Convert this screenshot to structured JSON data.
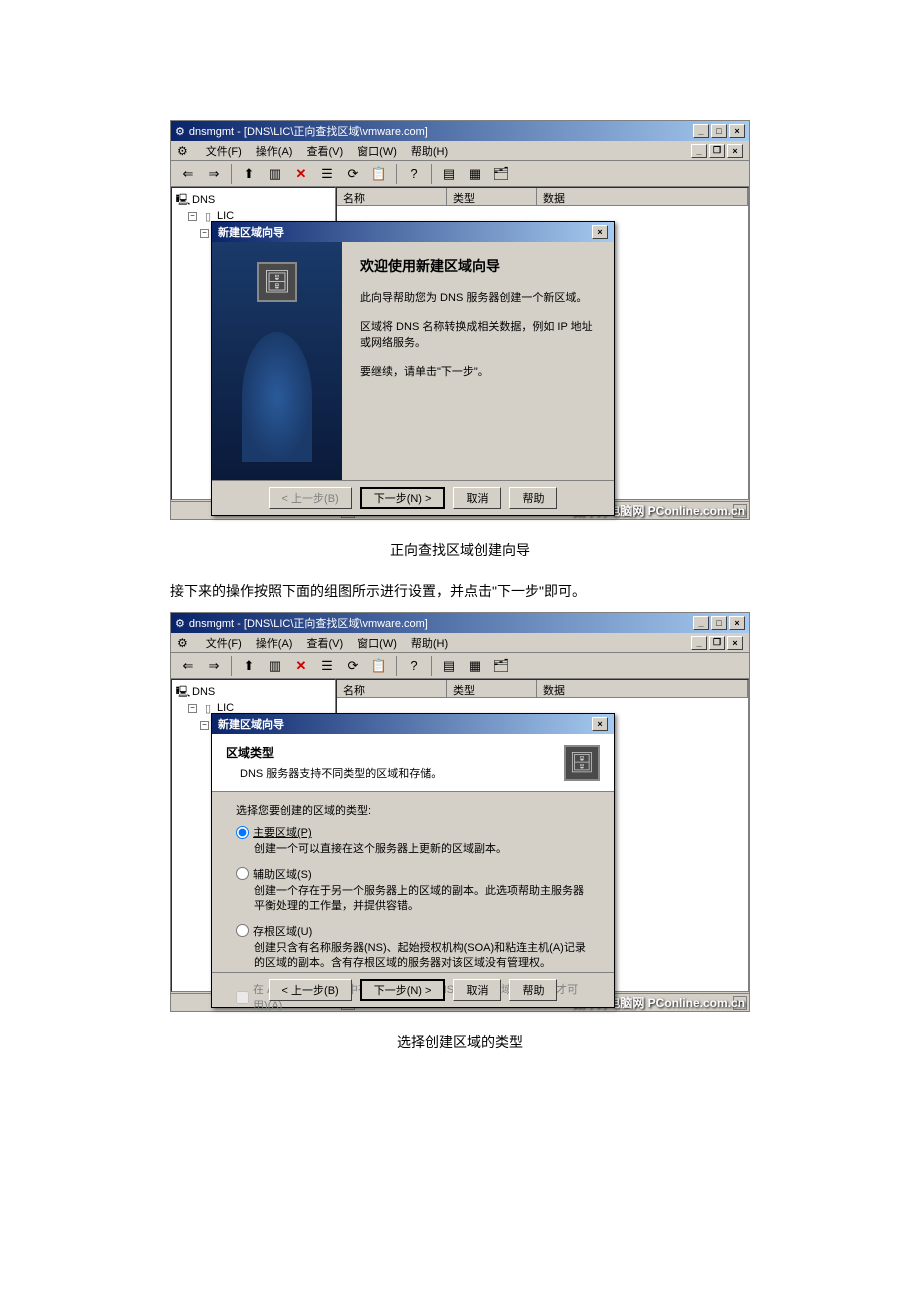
{
  "caption1": "正向查找区域创建向导",
  "desc_text": "接下来的操作按照下面的组图所示进行设置，并点击\"下一步\"即可。",
  "caption2": "选择创建区域的类型",
  "app_title": "dnsmgmt - [DNS\\LIC\\正向查找区域\\vmware.com]",
  "menu": {
    "file": "文件(F)",
    "action": "操作(A)",
    "view": "查看(V)",
    "window": "窗口(W)",
    "help": "帮助(H)"
  },
  "tree": {
    "root": "DNS",
    "server": "LIC",
    "forward_zone": "正向查找区域"
  },
  "list_headers": {
    "name": "名称",
    "type": "类型",
    "data": "数据"
  },
  "wizard1": {
    "title": "新建区域向导",
    "heading": "欢迎使用新建区域向导",
    "p1": "此向导帮助您为 DNS 服务器创建一个新区域。",
    "p2": "区域将 DNS 名称转换成相关数据，例如 IP 地址或网络服务。",
    "p3": "要继续，请单击\"下一步\"。",
    "btn_back": "< 上一步(B)",
    "btn_next": "下一步(N) >",
    "btn_cancel": "取消",
    "btn_help": "帮助"
  },
  "wizard2": {
    "title": "新建区域向导",
    "heading": "区域类型",
    "subheading": "DNS 服务器支持不同类型的区域和存储。",
    "select_label": "选择您要创建的区域的类型:",
    "opt1_label": "主要区域(P)",
    "opt1_desc": "创建一个可以直接在这个服务器上更新的区域副本。",
    "opt2_label": "辅助区域(S)",
    "opt2_desc": "创建一个存在于另一个服务器上的区域的副本。此选项帮助主服务器平衡处理的工作量，并提供容错。",
    "opt3_label": "存根区域(U)",
    "opt3_desc": "创建只含有名称服务器(NS)、起始授权机构(SOA)和粘连主机(A)记录的区域的副本。含有存根区域的服务器对该区域没有管理权。",
    "checkbox_label": "在 Active Directory 中存储区域(只有 DNS 服务器是域控制器时才可用)(A)",
    "btn_back": "< 上一步(B)",
    "btn_next": "下一步(N) >",
    "btn_cancel": "取消",
    "btn_help": "帮助"
  },
  "watermark": "太平洋电脑网 PConline.com.cn"
}
